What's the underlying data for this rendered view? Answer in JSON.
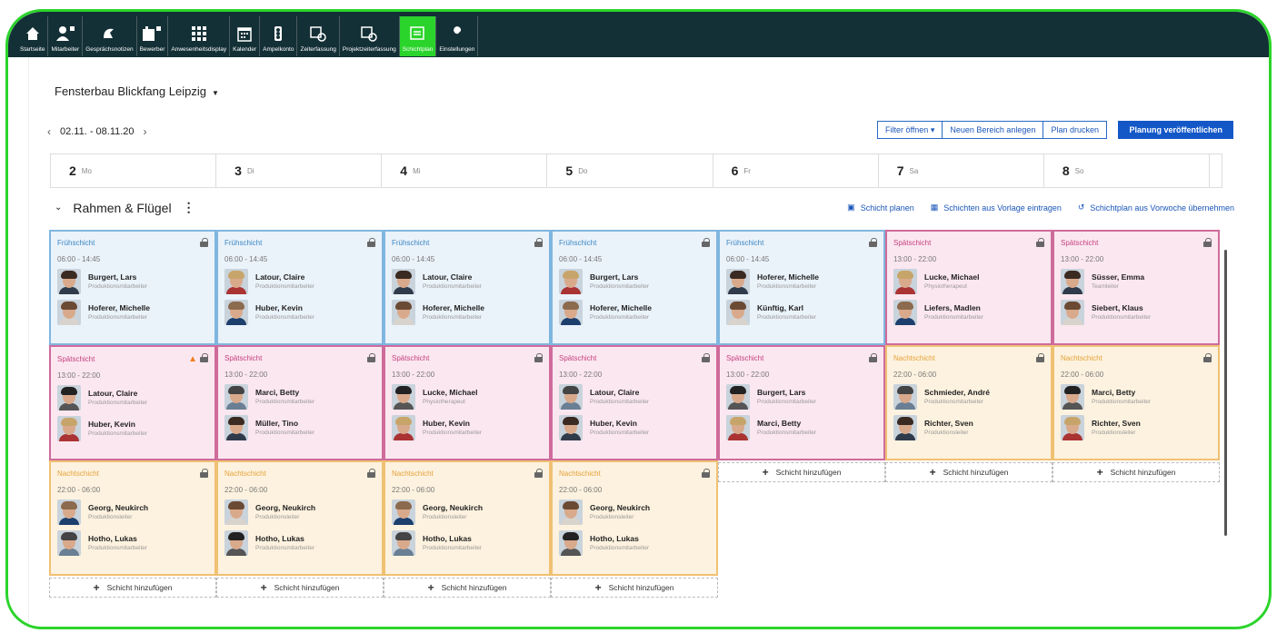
{
  "nav": [
    {
      "label": "Startseite",
      "icon": "home-icon"
    },
    {
      "label": "Mitarbeiter",
      "icon": "user-icon"
    },
    {
      "label": "Gesprächsnotizen",
      "icon": "notes-icon"
    },
    {
      "label": "Bewerber",
      "icon": "applicant-icon"
    },
    {
      "label": "Anwesenheitsdisplay",
      "icon": "grid-icon"
    },
    {
      "label": "Kalender",
      "icon": "calendar-icon"
    },
    {
      "label": "Ampelkonto",
      "icon": "traffic-light-icon"
    },
    {
      "label": "Zeiterfassung",
      "icon": "time-icon"
    },
    {
      "label": "Projektzeiterfassung",
      "icon": "project-time-icon"
    },
    {
      "label": "Schichtplan",
      "icon": "shiftplan-icon"
    },
    {
      "label": "Einstellungen",
      "icon": "wrench-icon"
    }
  ],
  "company": "Fensterbau Blickfang Leipzig",
  "week": "02.11. - 08.11.20",
  "buttons": {
    "filter": "Filter öffnen",
    "new_area": "Neuen Bereich anlegen",
    "print": "Plan drucken",
    "publish": "Planung veröffentlichen"
  },
  "days": [
    {
      "num": "2",
      "wd": "Mo"
    },
    {
      "num": "3",
      "wd": "Di"
    },
    {
      "num": "4",
      "wd": "Mi"
    },
    {
      "num": "5",
      "wd": "Do"
    },
    {
      "num": "6",
      "wd": "Fr"
    },
    {
      "num": "7",
      "wd": "Sa"
    },
    {
      "num": "8",
      "wd": "So"
    }
  ],
  "area": {
    "name": "Rahmen & Flügel",
    "actions": [
      "Schicht planen",
      "Schichten aus Vorlage eintragen",
      "Schichtplan aus Vorwoche übernehmen"
    ]
  },
  "add_label": "Schicht hinzufügen",
  "columns": [
    [
      {
        "type": "frueh",
        "name": "Frühschicht",
        "time": "06:00 - 14:45",
        "people": [
          [
            "Burgert, Lars",
            "Produktionsmitarbeiter"
          ],
          [
            "Hoferer, Michelle",
            "Produktionsmitarbeiter"
          ]
        ]
      },
      {
        "type": "spaet",
        "name": "Spätschicht",
        "time": "13:00 - 22:00",
        "warning": true,
        "people": [
          [
            "Latour, Claire",
            "Produktionsmitarbeiter"
          ],
          [
            "Huber, Kevin",
            "Produktionsmitarbeiter"
          ]
        ]
      },
      {
        "type": "nacht",
        "name": "Nachtschicht",
        "time": "22:00 - 06:00",
        "people": [
          [
            "Georg, Neukirch",
            "Produktionsleiter"
          ],
          [
            "Hotho, Lukas",
            "Produktionsmitarbeiter"
          ]
        ]
      }
    ],
    [
      {
        "type": "frueh",
        "name": "Frühschicht",
        "time": "06:00 - 14:45",
        "people": [
          [
            "Latour, Claire",
            "Produktionsmitarbeiter"
          ],
          [
            "Huber, Kevin",
            "Produktionsmitarbeiter"
          ]
        ]
      },
      {
        "type": "spaet",
        "name": "Spätschicht",
        "time": "13:00 - 22:00",
        "people": [
          [
            "Marci, Betty",
            "Produktionsmitarbeiter"
          ],
          [
            "Müller, Tino",
            "Produktionsmitarbeiter"
          ]
        ]
      },
      {
        "type": "nacht",
        "name": "Nachtschicht",
        "time": "22:00 - 06:00",
        "people": [
          [
            "Georg, Neukirch",
            "Produktionsleiter"
          ],
          [
            "Hotho, Lukas",
            "Produktionsmitarbeiter"
          ]
        ]
      }
    ],
    [
      {
        "type": "frueh",
        "name": "Frühschicht",
        "time": "06:00 - 14:45",
        "people": [
          [
            "Latour, Claire",
            "Produktionsmitarbeiter"
          ],
          [
            "Hoferer, Michelle",
            "Produktionsmitarbeiter"
          ]
        ]
      },
      {
        "type": "spaet",
        "name": "Spätschicht",
        "time": "13:00 - 22:00",
        "people": [
          [
            "Lucke, Michael",
            "Physiotherapeut"
          ],
          [
            "Huber, Kevin",
            "Produktionsmitarbeiter"
          ]
        ]
      },
      {
        "type": "nacht",
        "name": "Nachtschicht",
        "time": "22:00 - 06:00",
        "people": [
          [
            "Georg, Neukirch",
            "Produktionsleiter"
          ],
          [
            "Hotho, Lukas",
            "Produktionsmitarbeiter"
          ]
        ]
      }
    ],
    [
      {
        "type": "frueh",
        "name": "Frühschicht",
        "time": "06:00 - 14:45",
        "people": [
          [
            "Burgert, Lars",
            "Produktionsmitarbeiter"
          ],
          [
            "Hoferer, Michelle",
            "Produktionsmitarbeiter"
          ]
        ]
      },
      {
        "type": "spaet",
        "name": "Spätschicht",
        "time": "13:00 - 22:00",
        "people": [
          [
            "Latour, Claire",
            "Produktionsmitarbeiter"
          ],
          [
            "Huber, Kevin",
            "Produktionsmitarbeiter"
          ]
        ]
      },
      {
        "type": "nacht",
        "name": "Nachtschicht",
        "time": "22:00 - 06:00",
        "people": [
          [
            "Georg, Neukirch",
            "Produktionsleiter"
          ],
          [
            "Hotho, Lukas",
            "Produktionsmitarbeiter"
          ]
        ]
      }
    ],
    [
      {
        "type": "frueh",
        "name": "Frühschicht",
        "time": "06:00 - 14:45",
        "people": [
          [
            "Hoferer, Michelle",
            "Produktionsmitarbeiter"
          ],
          [
            "Künftig, Karl",
            "Produktionsmitarbeiter"
          ]
        ]
      },
      {
        "type": "spaet",
        "name": "Spätschicht",
        "time": "13:00 - 22:00",
        "people": [
          [
            "Burgert, Lars",
            "Produktionsmitarbeiter"
          ],
          [
            "Marci, Betty",
            "Produktionsmitarbeiter"
          ]
        ]
      }
    ],
    [
      {
        "type": "spaet",
        "name": "Spätschicht",
        "time": "13:00 - 22:00",
        "people": [
          [
            "Lucke, Michael",
            "Physiotherapeut"
          ],
          [
            "Liefers, Madlen",
            "Produktionsmitarbeiter"
          ]
        ]
      },
      {
        "type": "nacht",
        "name": "Nachtschicht",
        "time": "22:00 - 06:00",
        "people": [
          [
            "Schmieder, André",
            "Produktionsmitarbeiter"
          ],
          [
            "Richter, Sven",
            "Produktionsleiter"
          ]
        ]
      }
    ],
    [
      {
        "type": "spaet",
        "name": "Spätschicht",
        "time": "13:00 - 22:00",
        "people": [
          [
            "Süsser, Emma",
            "Teamleiter"
          ],
          [
            "Siebert, Klaus",
            "Produktionsmitarbeiter"
          ]
        ]
      },
      {
        "type": "nacht",
        "name": "Nachtschicht",
        "time": "22:00 - 06:00",
        "people": [
          [
            "Marci, Betty",
            "Produktionsmitarbeiter"
          ],
          [
            "Richter, Sven",
            "Produktionsleiter"
          ]
        ]
      }
    ]
  ]
}
